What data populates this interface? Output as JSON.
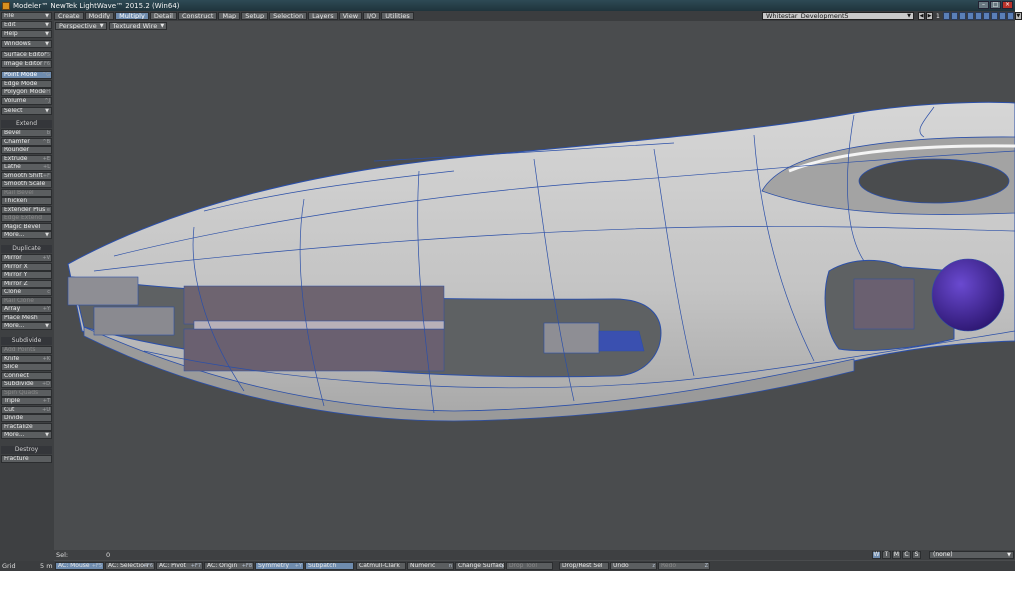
{
  "window": {
    "title": "Modeler™ NewTek LightWave™ 2015.2 (Win64)"
  },
  "tabs": [
    {
      "label": "Create",
      "selected": false
    },
    {
      "label": "Modify",
      "selected": false
    },
    {
      "label": "Multiply",
      "selected": true
    },
    {
      "label": "Detail",
      "selected": false
    },
    {
      "label": "Construct",
      "selected": false
    },
    {
      "label": "Map",
      "selected": false
    },
    {
      "label": "Setup",
      "selected": false
    },
    {
      "label": "Selection",
      "selected": false
    },
    {
      "label": "Layers",
      "selected": false
    },
    {
      "label": "View",
      "selected": false
    },
    {
      "label": "I/O",
      "selected": false
    },
    {
      "label": "Utilities",
      "selected": false
    }
  ],
  "document": {
    "name": "Whitestar_Development5"
  },
  "layer": {
    "number": "1"
  },
  "sidebar": {
    "file": "File",
    "edit": "Edit",
    "help": "Help",
    "windows": "Windows",
    "surface_editor": {
      "label": "Surface Editor",
      "shortcut": "F5"
    },
    "image_editor": {
      "label": "Image Editor",
      "shortcut": "F6"
    },
    "point_mode": {
      "label": "Point Mode",
      "shortcut": "^G"
    },
    "edge_mode": {
      "label": "Edge Mode",
      "shortcut": ""
    },
    "polygon_mode": {
      "label": "Polygon Mode",
      "shortcut": "^H"
    },
    "volume": {
      "label": "Volume",
      "shortcut": "^J"
    },
    "select": "Select",
    "extend_header": "Extend",
    "extend": [
      {
        "label": "Bevel",
        "shortcut": "b",
        "disabled": false
      },
      {
        "label": "Chamfer",
        "shortcut": "^B",
        "disabled": false
      },
      {
        "label": "Rounder",
        "shortcut": "",
        "disabled": false
      },
      {
        "label": "Extrude",
        "shortcut": "+E",
        "disabled": false
      },
      {
        "label": "Lathe",
        "shortcut": "+L",
        "disabled": false
      },
      {
        "label": "Smooth Shift",
        "shortcut": "+F",
        "disabled": false
      },
      {
        "label": "Smooth Scale",
        "shortcut": "",
        "disabled": false
      },
      {
        "label": "Rail Bevel",
        "shortcut": "",
        "disabled": true
      },
      {
        "label": "Thicken",
        "shortcut": "",
        "disabled": false
      },
      {
        "label": "Extender Plus",
        "shortcut": "e",
        "disabled": false
      },
      {
        "label": "Edge Extend",
        "shortcut": "",
        "disabled": true
      },
      {
        "label": "Magic Bevel",
        "shortcut": "",
        "disabled": false
      },
      {
        "label": "More...",
        "shortcut": "",
        "disabled": false
      }
    ],
    "duplicate_header": "Duplicate",
    "duplicate": [
      {
        "label": "Mirror",
        "shortcut": "+V",
        "disabled": false
      },
      {
        "label": "Mirror X",
        "shortcut": "",
        "disabled": false
      },
      {
        "label": "Mirror Y",
        "shortcut": "",
        "disabled": false
      },
      {
        "label": "Mirror Z",
        "shortcut": "",
        "disabled": false
      },
      {
        "label": "Clone",
        "shortcut": "c",
        "disabled": false
      },
      {
        "label": "Rail Clone",
        "shortcut": "",
        "disabled": true
      },
      {
        "label": "Array",
        "shortcut": "+Y",
        "disabled": false
      },
      {
        "label": "Place Mesh",
        "shortcut": "",
        "disabled": false
      },
      {
        "label": "More...",
        "shortcut": "",
        "disabled": false
      }
    ],
    "subdivide_header": "Subdivide",
    "subdivide": [
      {
        "label": "Add Points",
        "shortcut": "",
        "disabled": true
      },
      {
        "label": "Knife",
        "shortcut": "+K",
        "disabled": false
      },
      {
        "label": "Slice",
        "shortcut": "",
        "disabled": false
      },
      {
        "label": "Connect",
        "shortcut": "",
        "disabled": false
      },
      {
        "label": "Subdivide",
        "shortcut": "+D",
        "disabled": false
      },
      {
        "label": "Spin Quads",
        "shortcut": "",
        "disabled": true
      },
      {
        "label": "Triple",
        "shortcut": "+T",
        "disabled": false
      },
      {
        "label": "Cut",
        "shortcut": "+U",
        "disabled": false
      },
      {
        "label": "Divide",
        "shortcut": "",
        "disabled": false
      },
      {
        "label": "Fractalize",
        "shortcut": "",
        "disabled": false
      },
      {
        "label": "More...",
        "shortcut": "",
        "disabled": false
      }
    ],
    "destroy_header": "Destroy",
    "destroy": [
      {
        "label": "Fracture",
        "shortcut": "",
        "disabled": false
      }
    ]
  },
  "viewport": {
    "projection": "Perspective",
    "render_mode": "Textured Wire"
  },
  "status": {
    "sel_label": "Sel:",
    "sel_count": "0",
    "select_modes": [
      "W",
      "T",
      "M",
      "C",
      "S"
    ],
    "surface": "(none)"
  },
  "bottombar": {
    "grid_label": "Grid",
    "grid_value": "5 m",
    "buttons": [
      {
        "label": "AC: Mouse",
        "shortcut": "+F5",
        "selected": true,
        "disabled": false
      },
      {
        "label": "AC: Selection",
        "shortcut": "+F6",
        "selected": false,
        "disabled": false
      },
      {
        "label": "AC: Pivot",
        "shortcut": "+F7",
        "selected": false,
        "disabled": false
      },
      {
        "label": "AC: Origin",
        "shortcut": "+F8",
        "selected": false,
        "disabled": false
      },
      {
        "label": "Symmetry",
        "shortcut": "+Y",
        "selected": true,
        "disabled": false
      },
      {
        "label": "Subpatch",
        "shortcut": "",
        "selected": true,
        "disabled": false
      },
      {
        "label": "Catmull-Clark",
        "shortcut": "",
        "selected": false,
        "disabled": false
      },
      {
        "label": "Numeric",
        "shortcut": "n",
        "selected": false,
        "disabled": false
      },
      {
        "label": "Change Surface",
        "shortcut": "q",
        "selected": false,
        "disabled": false
      },
      {
        "label": "Drop Tool",
        "shortcut": "",
        "selected": false,
        "disabled": true
      },
      {
        "label": "Drop/Rest Sel",
        "shortcut": "",
        "selected": false,
        "disabled": false
      },
      {
        "label": "Undo",
        "shortcut": "z",
        "selected": false,
        "disabled": false
      },
      {
        "label": "Redo",
        "shortcut": "Z",
        "selected": false,
        "disabled": true
      }
    ]
  },
  "colors": {
    "accent": "#6f8cae",
    "viewport_bg": "#4a4c4e",
    "wire": "#2b4fa8",
    "hull": "#c9c9c9",
    "sphere": "#4a2a9a"
  }
}
